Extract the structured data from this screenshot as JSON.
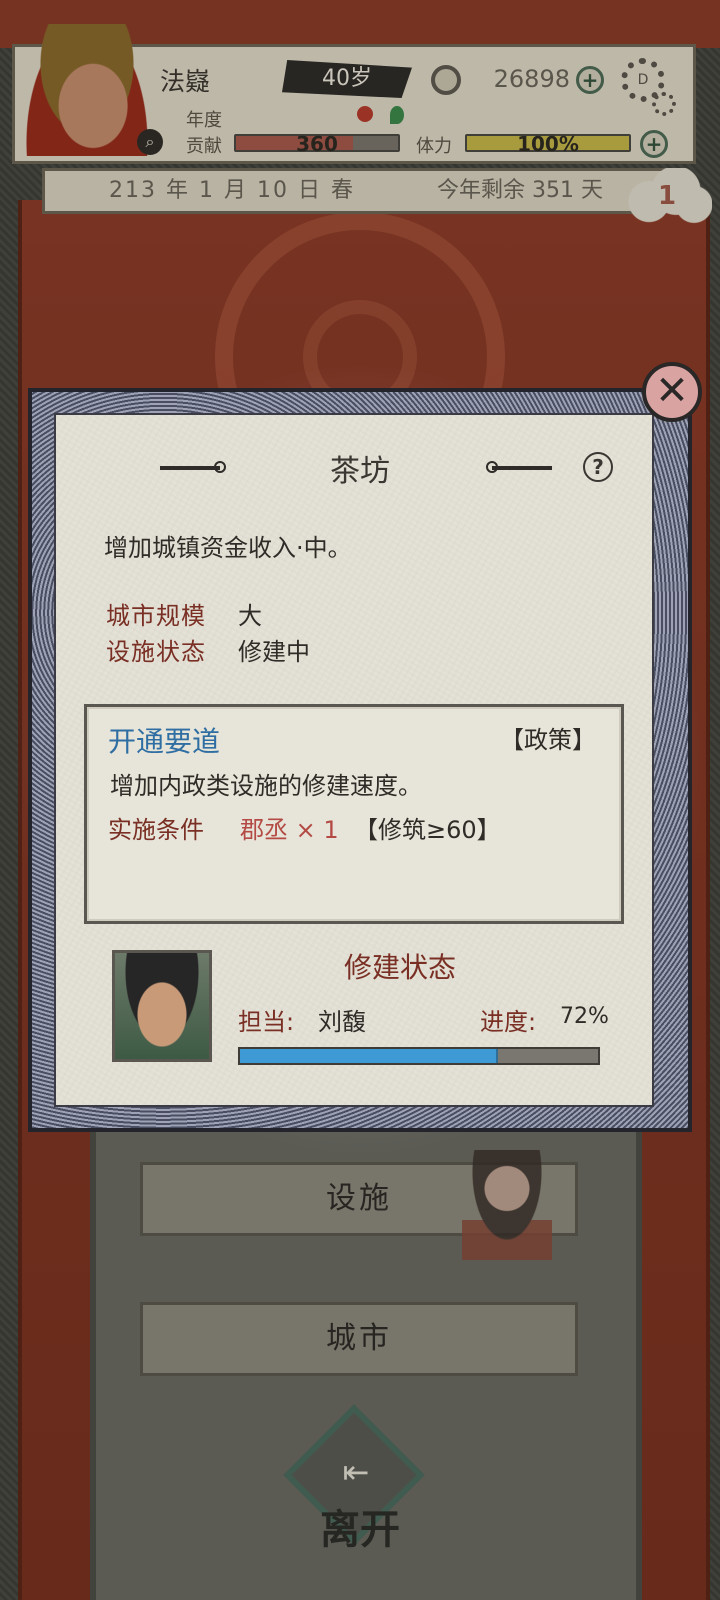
{
  "player": {
    "name": "法嶷",
    "age": "40岁",
    "money": "26898",
    "year_label": "年度",
    "contribution_label": "贡献",
    "contribution_value": "360",
    "contribution_fraction": 0.72,
    "stamina_label": "体力",
    "stamina_value": "100%",
    "stamina_fraction": 1.0
  },
  "date": {
    "current": "213 年 1 月 10 日 春",
    "remaining": "今年剩余 351 天",
    "badge": "1"
  },
  "dialog": {
    "title": "茶坊",
    "description": "增加城镇资金收入·中。",
    "city_size_label": "城市规模",
    "city_size_value": "大",
    "facility_status_label": "设施状态",
    "facility_status_value": "修建中",
    "policy": {
      "name": "开通要道",
      "tag": "【政策】",
      "description": "增加内政类设施的修建速度。",
      "condition_label": "实施条件",
      "condition_role": "郡丞 × 1",
      "condition_requirement": "【修筑≥60】"
    },
    "construction": {
      "title": "修建状态",
      "assignee_label": "担当:",
      "assignee_name": "刘馥",
      "progress_label": "进度:",
      "progress_text": "72%",
      "progress_fraction": 0.72
    }
  },
  "background_menu": {
    "facilities_label": "设施",
    "city_label": "城市",
    "exit_label": "离开"
  },
  "colors": {
    "accent_red": "#7a2f24",
    "policy_blue": "#2f6ea2",
    "progress_blue": "#3d9ad4",
    "contribution_bar": "#a8584a",
    "stamina_bar": "#c9b948"
  },
  "icons": [
    "search-icon",
    "coin-icon",
    "gear-icon",
    "close-icon",
    "help-icon",
    "exit-icon",
    "flower-icon",
    "leaf-icon"
  ]
}
